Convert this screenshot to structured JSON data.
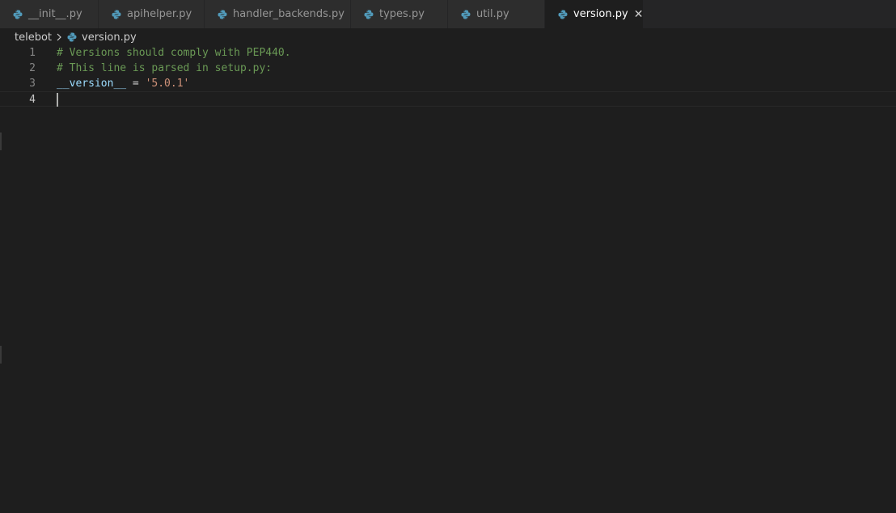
{
  "tabs": [
    {
      "label": "__init__.py",
      "active": false
    },
    {
      "label": "apihelper.py",
      "active": false
    },
    {
      "label": "handler_backends.py",
      "active": false
    },
    {
      "label": "types.py",
      "active": false
    },
    {
      "label": "util.py",
      "active": false
    },
    {
      "label": "version.py",
      "active": true,
      "close_glyph": "✕"
    }
  ],
  "breadcrumb": {
    "folder": "telebot",
    "file": "version.py"
  },
  "editor": {
    "lines": [
      {
        "number": "1",
        "comment": "# Versions should comply with PEP440."
      },
      {
        "number": "2",
        "comment": "# This line is parsed in setup.py:"
      },
      {
        "number": "3",
        "var": "__version__",
        "op": " = ",
        "str": "'5.0.1'"
      },
      {
        "number": "4",
        "text": ""
      }
    ]
  },
  "icons": {
    "file_icon": "python-file-icon",
    "python_blue": "#519aba",
    "python_yellow": "#e8d44d"
  }
}
